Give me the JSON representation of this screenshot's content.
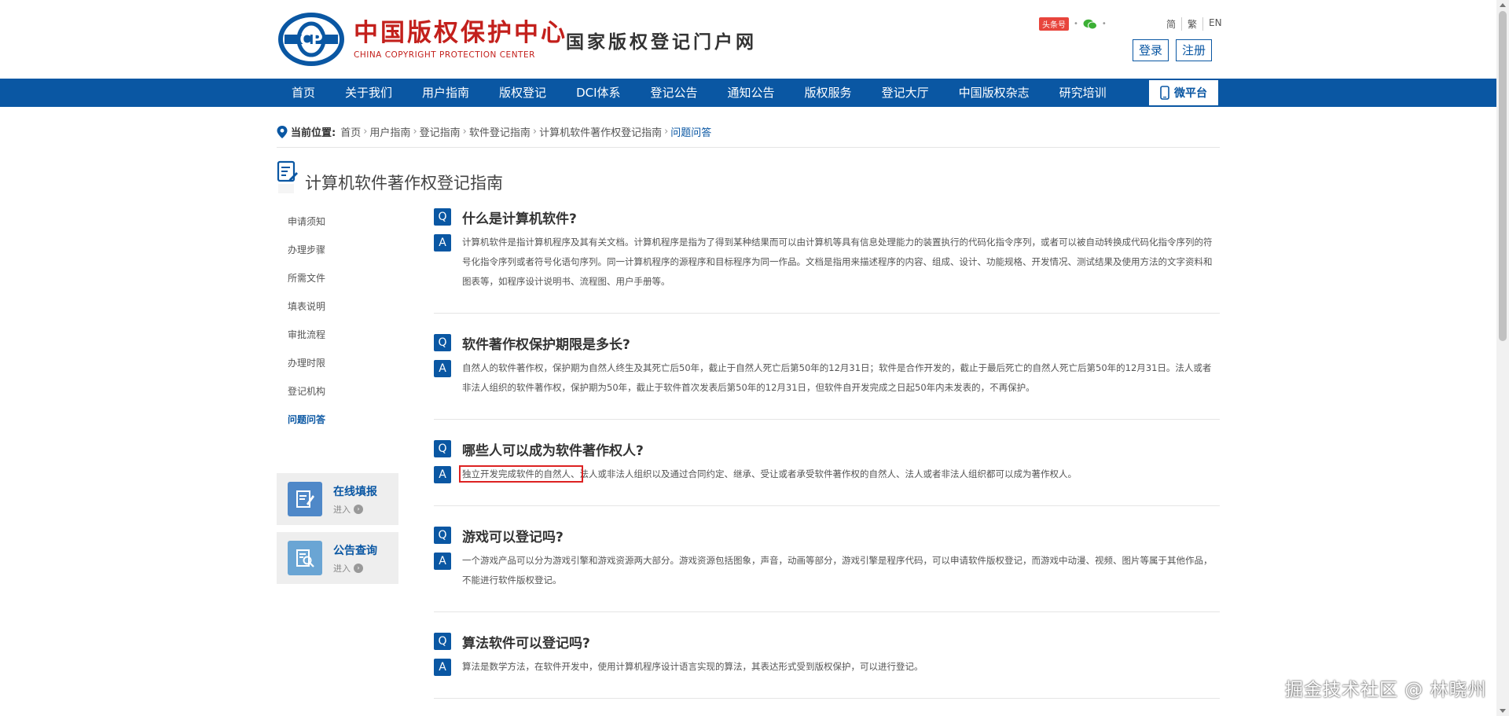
{
  "header": {
    "logo_cn": "中国版权保护中心",
    "logo_en": "CHINA COPYRIGHT PROTECTION CENTER",
    "portal_name": "国家版权登记门户网",
    "social": {
      "toutiao": "头条号",
      "wechat": "wechat-icon"
    },
    "lang": [
      "简",
      "繁",
      "EN"
    ],
    "login": "登录",
    "register": "注册"
  },
  "nav": {
    "items": [
      "首页",
      "关于我们",
      "用户指南",
      "版权登记",
      "DCI体系",
      "登记公告",
      "通知公告",
      "版权服务",
      "登记大厅",
      "中国版权杂志",
      "研究培训"
    ],
    "weiping": "微平台"
  },
  "breadcrumb": {
    "label": "当前位置:",
    "items": [
      "首页",
      "用户指南",
      "登记指南",
      "软件登记指南",
      "计算机软件著作权登记指南"
    ],
    "current": "问题问答"
  },
  "section_title": "计算机软件著作权登记指南",
  "sidebar": {
    "items": [
      "申请须知",
      "办理步骤",
      "所需文件",
      "填表说明",
      "审批流程",
      "办理时限",
      "登记机构",
      "问题问答"
    ],
    "cards": [
      {
        "title": "在线填报",
        "enter": "进入"
      },
      {
        "title": "公告查询",
        "enter": "进入"
      }
    ]
  },
  "qa": [
    {
      "q_badge": "Q",
      "a_badge": "A",
      "question": "什么是计算机软件?",
      "answer": "计算机软件是指计算机程序及其有关文档。计算机程序是指为了得到某种结果而可以由计算机等具有信息处理能力的装置执行的代码化指令序列，或者可以被自动转换成代码化指令序列的符号化指令序列或者符号化语句序列。同一计算机程序的源程序和目标程序为同一作品。文档是指用来描述程序的内容、组成、设计、功能规格、开发情况、测试结果及使用方法的文字资料和图表等，如程序设计说明书、流程图、用户手册等。"
    },
    {
      "q_badge": "Q",
      "a_badge": "A",
      "question": "软件著作权保护期限是多长?",
      "answer": "自然人的软件著作权，保护期为自然人终生及其死亡后50年，截止于自然人死亡后第50年的12月31日；软件是合作开发的，截止于最后死亡的自然人死亡后第50年的12月31日。法人或者非法人组织的软件著作权，保护期为50年，截止于软件首次发表后第50年的12月31日，但软件自开发完成之日起50年内未发表的，不再保护。"
    },
    {
      "q_badge": "Q",
      "a_badge": "A",
      "question": "哪些人可以成为软件著作权人?",
      "answer_highlight": "独立开发完成软件的自然人、",
      "answer": "法人或非法人组织以及通过合同约定、继承、受让或者承受软件著作权的自然人、法人或者非法人组织都可以成为著作权人。"
    },
    {
      "q_badge": "Q",
      "a_badge": "A",
      "question": "游戏可以登记吗?",
      "answer": "一个游戏产品可以分为游戏引擎和游戏资源两大部分。游戏资源包括图象，声音，动画等部分，游戏引擎是程序代码，可以申请软件版权登记，而游戏中动漫、视频、图片等属于其他作品，不能进行软件版权登记。"
    },
    {
      "q_badge": "Q",
      "a_badge": "A",
      "question": "算法软件可以登记吗?",
      "answer": "算法是数学方法，在软件开发中，使用计算机程序设计语言实现的算法，其表达形式受到版权保护，可以进行登记。"
    }
  ],
  "watermark": "掘金技术社区 @ 林晓州",
  "colors": {
    "brand_blue": "#0a57a3",
    "logo_red": "#c3201c",
    "highlight_red": "#dd2222"
  }
}
